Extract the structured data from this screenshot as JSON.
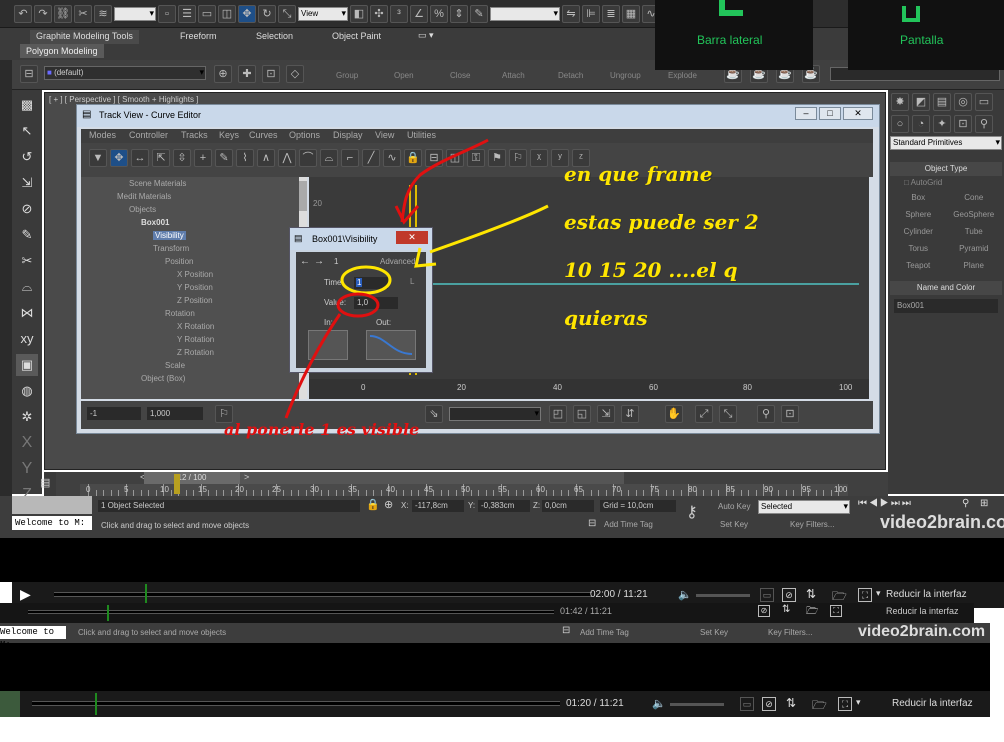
{
  "toolbar": {
    "selection_dropdown": "",
    "view_dropdown": "View",
    "search_dropdown": ""
  },
  "ribbon": {
    "tabs": [
      "Graphite Modeling Tools",
      "Freeform",
      "Selection",
      "Object Paint"
    ],
    "subtab": "Polygon Modeling",
    "layer_dropdown": "(default)",
    "groups": [
      "Group",
      "Open",
      "Close",
      "Attach",
      "Detach",
      "Ungroup",
      "Explode"
    ]
  },
  "overlay": {
    "sidebar_label": "Barra lateral",
    "screen_label": "Pantalla"
  },
  "viewport": {
    "label": "[ + ] [ Perspective ] [ Smooth + Highlights ]"
  },
  "curve_editor": {
    "title": "Track View - Curve Editor",
    "menu": [
      "Modes",
      "Controller",
      "Tracks",
      "Keys",
      "Curves",
      "Options",
      "Display",
      "View",
      "Utilities"
    ],
    "tree": [
      "Scene Materials",
      "Medit Materials",
      "Objects",
      "Box001",
      "Visibility",
      "Transform",
      "Position",
      "X Position",
      "Y Position",
      "Z Position",
      "Rotation",
      "X Rotation",
      "Y Rotation",
      "Z Rotation",
      "Scale",
      "Object (Box)"
    ],
    "graph_value": "20",
    "graph_ticks": [
      "0",
      "20",
      "40",
      "60",
      "80",
      "100"
    ],
    "field_left": "-1",
    "field_right": "1,000"
  },
  "dialog": {
    "title": "Box001\\Visibility",
    "key_num": "1",
    "advanced": "Advanced",
    "time_label": "Time:",
    "time_value": "1",
    "value_label": "Value:",
    "value_value": "1,0",
    "in_label": "In:",
    "out_label": "Out:"
  },
  "right_panel": {
    "object_type": "Object Type",
    "autogrid": "AutoGrid",
    "dropdown": "Standard Primitives",
    "buttons": [
      "Box",
      "Cone",
      "Sphere",
      "GeoSphere",
      "Cylinder",
      "Tube",
      "Torus",
      "Pyramid",
      "Teapot",
      "Plane"
    ],
    "name_color": "Name and Color",
    "name": "Box001"
  },
  "timeslider": {
    "frame": "12 / 100",
    "ticks": [
      "0",
      "5",
      "10",
      "15",
      "20",
      "25",
      "30",
      "35",
      "40",
      "45",
      "50",
      "55",
      "60",
      "65",
      "70",
      "75",
      "80",
      "85",
      "90",
      "95",
      "100"
    ]
  },
  "status": {
    "selected": "1 Object Selected",
    "prompt": "Click and drag to select and move objects",
    "x": "-117,8cm",
    "y": "-0,383cm",
    "z": "0,0cm",
    "grid": "Grid = 10,0cm",
    "add_time_tag": "Add Time Tag",
    "auto_key": "Auto Key",
    "set_key": "Set Key",
    "selected_dropdown": "Selected",
    "key_filters": "Key Filters...",
    "listener": "Welcome to M:"
  },
  "players": [
    {
      "time": "02:00 / 11:21",
      "progress": 0.17,
      "reduce": "Reducir la interfaz"
    },
    {
      "time": "01:42 / 11:21",
      "progress": 0.15,
      "reduce": "Reducir la interfaz"
    },
    {
      "time": "01:20 / 11:21",
      "progress": 0.12,
      "reduce": "Reducir la interfaz"
    }
  ],
  "watermark": "video2brain.com",
  "annotations": {
    "line1": "en que frame",
    "line2": "estas puede ser 2",
    "line3": "10 15 20 ....el q",
    "line4": "quieras",
    "red": "al ponerle 1 es visible"
  },
  "colors": {
    "annotation_yellow": "#ffe600",
    "annotation_red": "#e01010",
    "overlay_green": "#22c45a",
    "playhead_green": "#1f8a1f"
  }
}
